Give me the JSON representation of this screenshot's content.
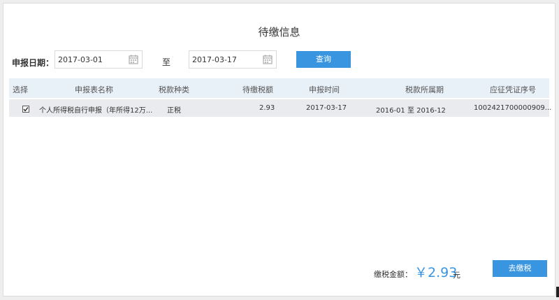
{
  "page": {
    "title": "待缴信息"
  },
  "filter": {
    "date_label": "申报日期：",
    "start_date": "2017-03-01",
    "to_label": "至",
    "end_date": "2017-03-17",
    "query_button": "查询"
  },
  "table": {
    "columns": [
      "选择",
      "申报表名称",
      "税款种类",
      "待缴税额",
      "申报时间",
      "税款所属期",
      "应征凭证序号"
    ],
    "rows": [
      {
        "checked": true,
        "name": "个人所得税自行申报（年所得12万...",
        "tax_type": "正税",
        "amount": "2.93",
        "declare_time": "2017-03-17",
        "period": "2016-01 至 2016-12",
        "voucher_no": "1002421700000909..."
      }
    ]
  },
  "footer": {
    "total_label": "缴税金额：",
    "total_amount": "￥2.93",
    "total_unit": "元",
    "pay_button": "去缴税"
  },
  "colors": {
    "accent": "#3a95e0",
    "header_bg": "#e8f0f8",
    "row_bg": "#e9ebee"
  }
}
